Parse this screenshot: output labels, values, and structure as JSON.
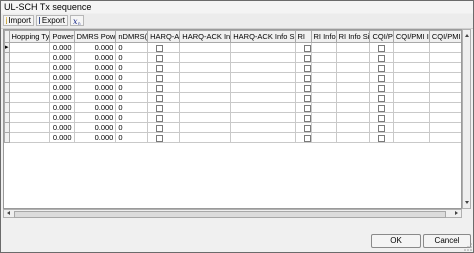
{
  "window": {
    "title": "UL-SCH Tx sequence"
  },
  "toolbar": {
    "import_label": "Import",
    "export_label": "Export"
  },
  "grid": {
    "columns": [
      "Hopping Ty",
      "Power",
      "DMRS Pow",
      "nDMRS(",
      "HARQ-A",
      "HARQ-ACK In",
      "HARQ-ACK Info S",
      "RI",
      "RI Info",
      "RI Info Si",
      "CQI/P",
      "CQI/PMI I",
      "CQI/PMI Info S"
    ],
    "current_row_marker": "▸",
    "rows": [
      {
        "power": "0.000",
        "dmrs": "0.000",
        "ndmrs": "0"
      },
      {
        "power": "0.000",
        "dmrs": "0.000",
        "ndmrs": "0"
      },
      {
        "power": "0.000",
        "dmrs": "0.000",
        "ndmrs": "0"
      },
      {
        "power": "0.000",
        "dmrs": "0.000",
        "ndmrs": "0"
      },
      {
        "power": "0.000",
        "dmrs": "0.000",
        "ndmrs": "0"
      },
      {
        "power": "0.000",
        "dmrs": "0.000",
        "ndmrs": "0"
      },
      {
        "power": "0.000",
        "dmrs": "0.000",
        "ndmrs": "0"
      },
      {
        "power": "0.000",
        "dmrs": "0.000",
        "ndmrs": "0"
      },
      {
        "power": "0.000",
        "dmrs": "0.000",
        "ndmrs": "0"
      },
      {
        "power": "0.000",
        "dmrs": "0.000",
        "ndmrs": "0"
      }
    ]
  },
  "buttons": {
    "ok_label": "OK",
    "cancel_label": "Cancel"
  }
}
